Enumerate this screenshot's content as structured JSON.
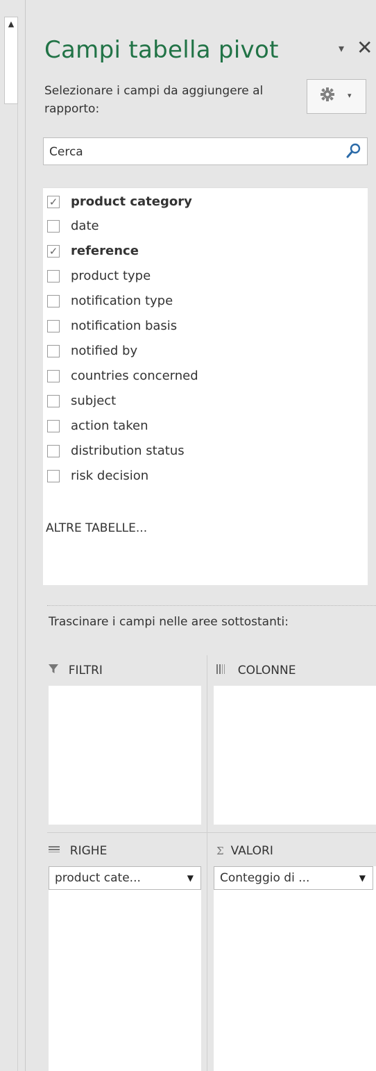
{
  "left_strip": {
    "scroll_up_glyph": "▲"
  },
  "pane": {
    "title": "Campi tabella pivot",
    "dropdown_glyph": "▾",
    "close_glyph": "✕",
    "subtitle": "Selezionare i campi da aggiungere al rapporto:",
    "tools_icon": "gear-icon",
    "tools_caret": "▾"
  },
  "search": {
    "placeholder": "Cerca",
    "icon": "search-icon"
  },
  "fields": [
    {
      "label": "product category",
      "checked": true
    },
    {
      "label": "date",
      "checked": false
    },
    {
      "label": "reference",
      "checked": true
    },
    {
      "label": "product type",
      "checked": false
    },
    {
      "label": "notification type",
      "checked": false
    },
    {
      "label": "notification basis",
      "checked": false
    },
    {
      "label": "notified by",
      "checked": false
    },
    {
      "label": "countries concerned",
      "checked": false
    },
    {
      "label": "subject",
      "checked": false
    },
    {
      "label": "action taken",
      "checked": false
    },
    {
      "label": "distribution status",
      "checked": false
    },
    {
      "label": "risk decision",
      "checked": false
    }
  ],
  "more_tables": "ALTRE TABELLE...",
  "drag_hint": "Trascinare i campi nelle aree sottostanti:",
  "areas": {
    "filters": {
      "label": "FILTRI",
      "icon": "filter-icon"
    },
    "columns": {
      "label": "COLONNE",
      "icon": "columns-icon"
    },
    "rows": {
      "label": "RIGHE",
      "icon": "rows-icon",
      "chip": "product cate..."
    },
    "values": {
      "label": "VALORI",
      "icon": "sigma-icon",
      "chip": "Conteggio di ..."
    }
  },
  "chip_caret": "▼"
}
